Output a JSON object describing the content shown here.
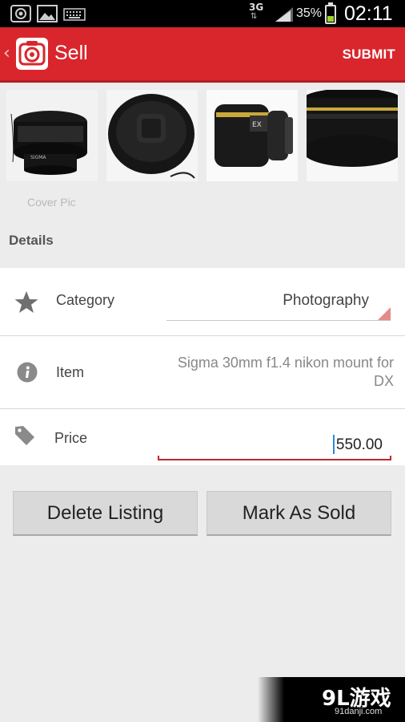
{
  "status_bar": {
    "network": "3G",
    "battery": "35%",
    "battery_level": 0.35,
    "time": "02:11",
    "left_icons": [
      "camera-icon",
      "image-icon",
      "keyboard-icon"
    ]
  },
  "action_bar": {
    "title": "Sell",
    "submit_label": "SUBMIT",
    "color": "#d9262c"
  },
  "photos": {
    "items": [
      "sigma-lens-photo",
      "lens-cap-photo",
      "lens-side-photo",
      "lens-closeup-photo"
    ],
    "cover_label": "Cover Pic"
  },
  "details": {
    "title": "Details",
    "category": {
      "label": "Category",
      "value": "Photography",
      "icon": "star-icon"
    },
    "item": {
      "label": "Item",
      "value": "Sigma 30mm f1.4 nikon mount for DX",
      "icon": "info-icon"
    },
    "price": {
      "label": "Price",
      "value": "550.00",
      "icon": "tag-icon"
    }
  },
  "buttons": {
    "delete": "Delete Listing",
    "mark_sold": "Mark As Sold"
  },
  "watermark": {
    "logo": "9L游戏",
    "url": "91danji.com"
  }
}
